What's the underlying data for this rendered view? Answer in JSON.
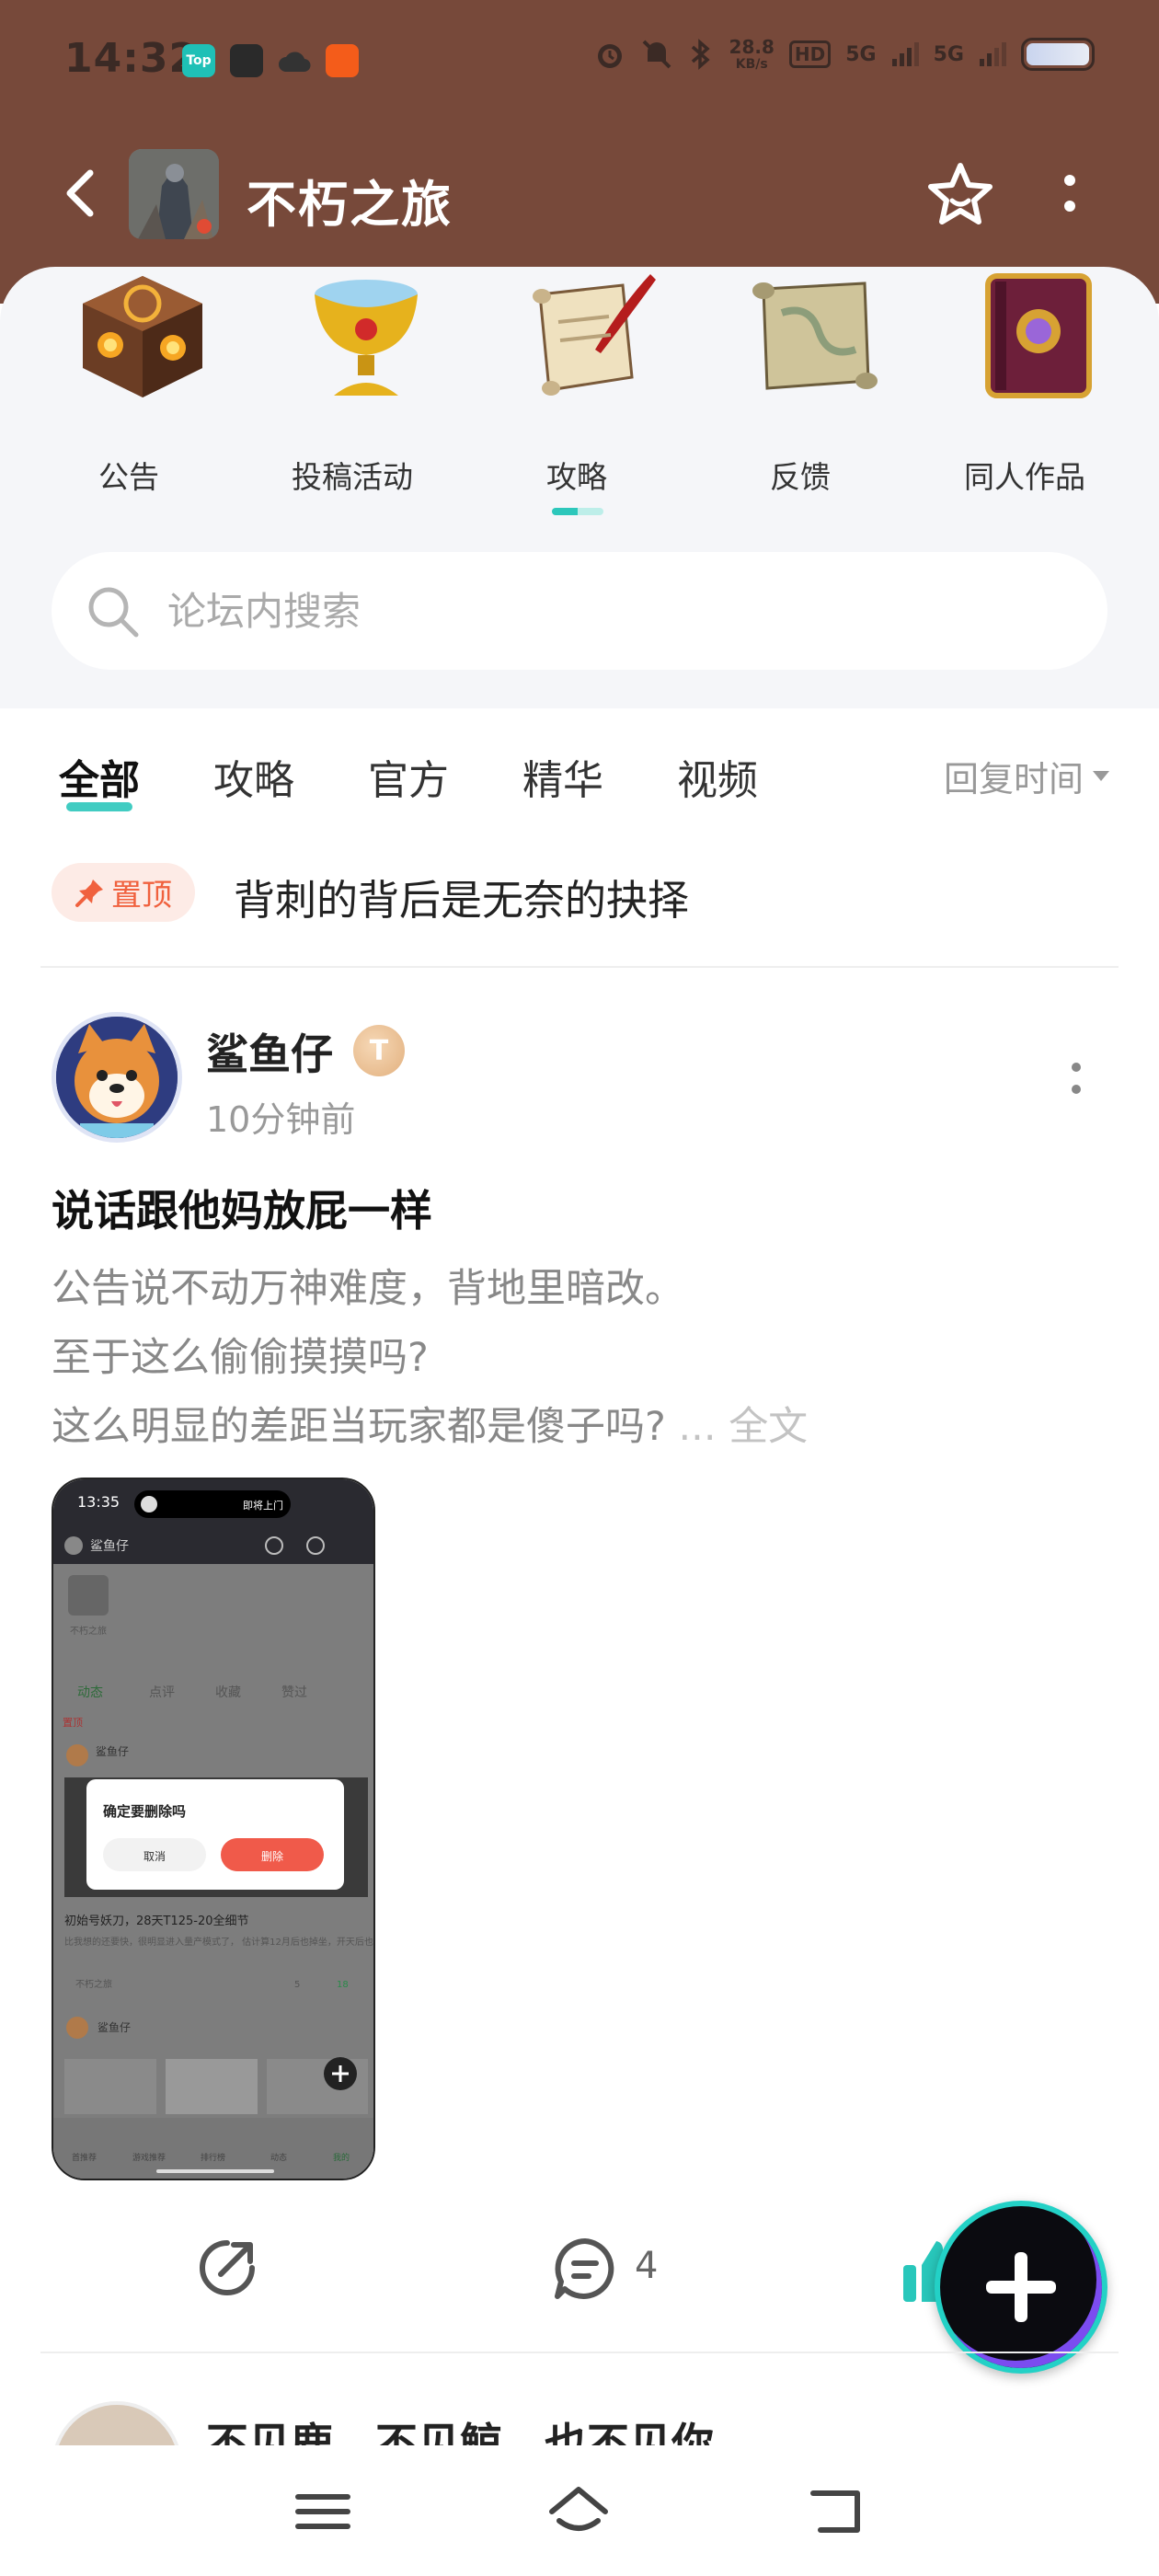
{
  "status_bar": {
    "time": "14:32",
    "app_icons": [
      {
        "name": "top-app-icon",
        "label": "Top",
        "color": "#1fc0b6"
      },
      {
        "name": "black-square-app-icon",
        "label": "",
        "color": "#2a2a2a"
      },
      {
        "name": "cloud-app-icon",
        "label": "",
        "color": "#333333"
      },
      {
        "name": "orange-app-icon",
        "label": "",
        "color": "#f45c1a"
      }
    ],
    "net_speed": "28.8",
    "net_unit": "KB/s",
    "hd_label": "HD",
    "sim_labels": [
      "5G",
      "5G"
    ]
  },
  "header": {
    "forum_title": "不朽之旅",
    "background_color": "#77493a"
  },
  "categories": [
    {
      "label": "公告",
      "icon": "cube-icon"
    },
    {
      "label": "投稿活动",
      "icon": "chalice-icon"
    },
    {
      "label": "攻略",
      "icon": "scroll-quill-icon"
    },
    {
      "label": "反馈",
      "icon": "map-scroll-icon"
    },
    {
      "label": "同人作品",
      "icon": "book-icon"
    }
  ],
  "search": {
    "placeholder": "论坛内搜索"
  },
  "tabs": {
    "items": [
      "全部",
      "攻略",
      "官方",
      "精华",
      "视频"
    ],
    "active_index": 0,
    "sort_label": "回复时间",
    "accent_color": "#2cc7bb"
  },
  "pinned": {
    "badge": "置顶",
    "title": "背刺的背后是无奈的抉择"
  },
  "post": {
    "username": "鲨鱼仔",
    "level": "T",
    "time": "10分钟前",
    "title": "说话跟他妈放屁一样",
    "body_lines": [
      "公告说不动万神难度，背地里暗改。",
      "至于这么偷偷摸摸吗?",
      "这么明显的差距当玩家都是傻子吗?"
    ],
    "ellipsis": "...",
    "read_more": "全文",
    "comment_count": "4",
    "screenshot": {
      "time": "13:35",
      "island_text": "即将上门",
      "user": "鲨鱼仔",
      "forum_name": "不朽之旅",
      "tabs": [
        "动态",
        "点评",
        "收藏",
        "赞过"
      ],
      "pinned": "置顶",
      "post_user": "鲨鱼仔",
      "dialog_title": "确定要删除吗",
      "cancel": "取消",
      "delete": "删除",
      "post_title": "初始号妖刀，28天T125-20全细节",
      "post_snippet": "比我想的还要快，很明显进入量产模式了，  估计算12月后也掉坐，开天后也神槽，再出了种咒做成量上145-30",
      "source": "不朽之旅",
      "comments": "5",
      "likes": "18",
      "user2": "鲨鱼仔",
      "nav": [
        "首推荐",
        "游戏推荐",
        "排行榜",
        "动态",
        "我的"
      ]
    }
  },
  "next_post": {
    "username": "不见鹿，不见鲸，也不见你"
  }
}
